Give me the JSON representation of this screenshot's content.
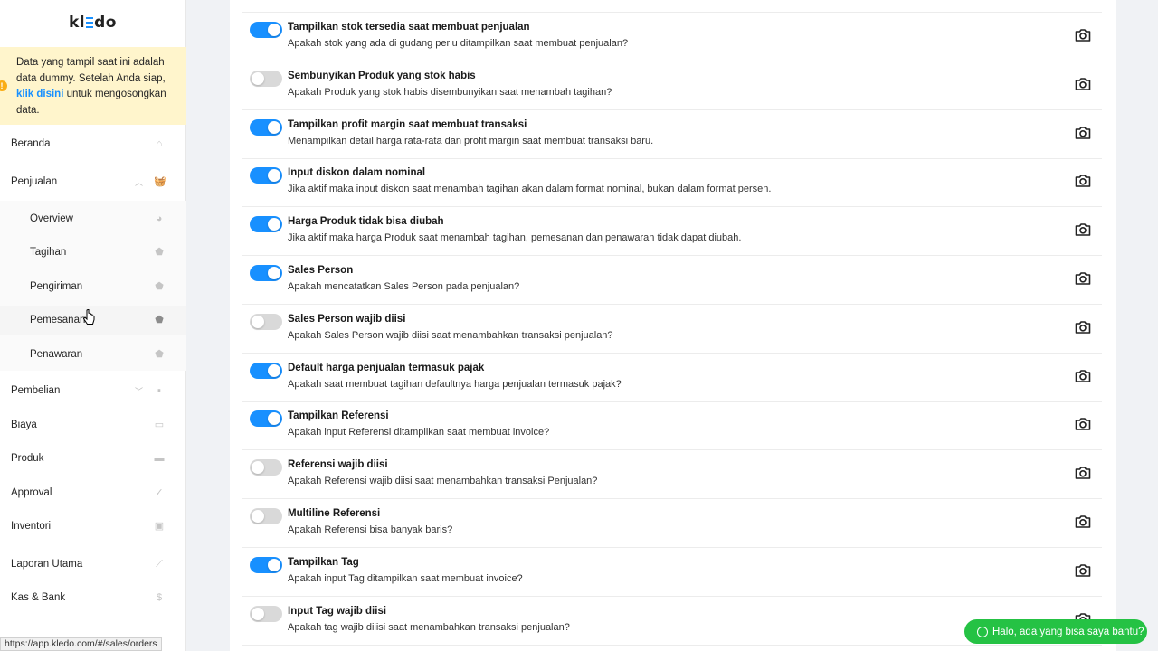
{
  "app": {
    "logo_text_left": "kl",
    "logo_text_right": "do"
  },
  "notice": {
    "text_before": "Data yang tampil saat ini adalah data dummy. Setelah Anda siap,",
    "link": "klik disini",
    "text_after": "untuk mengosongkan data."
  },
  "sidebar": {
    "items": [
      {
        "label": "Beranda",
        "icon": "home-icon"
      },
      {
        "label": "Penjualan",
        "icon": "basket-icon",
        "expanded": true
      },
      {
        "label": "Overview",
        "icon": "pie-icon"
      },
      {
        "label": "Tagihan",
        "icon": "tag-icon"
      },
      {
        "label": "Pengiriman",
        "icon": "tag-icon"
      },
      {
        "label": "Pemesanan",
        "icon": "tags-icon"
      },
      {
        "label": "Penawaran",
        "icon": "tag-icon"
      },
      {
        "label": "Pembelian",
        "icon": "bag-icon",
        "expanded": false
      },
      {
        "label": "Biaya",
        "icon": "card-icon"
      },
      {
        "label": "Produk",
        "icon": "box-icon"
      },
      {
        "label": "Approval",
        "icon": "check-icon"
      },
      {
        "label": "Inventori",
        "icon": "inventory-icon"
      },
      {
        "label": "Laporan Utama",
        "icon": "chart-icon"
      },
      {
        "label": "Kas & Bank",
        "icon": "dollar-icon"
      }
    ]
  },
  "status_bar": {
    "url": "https://app.kledo.com/#/sales/orders"
  },
  "settings": [
    {
      "title": "Tampilkan stok tersedia saat membuat penjualan",
      "desc": "Apakah stok yang ada di gudang perlu ditampilkan saat membuat penjualan?",
      "on": true
    },
    {
      "title": "Sembunyikan Produk yang stok habis",
      "desc": "Apakah Produk yang stok habis disembunyikan saat menambah tagihan?",
      "on": false
    },
    {
      "title": "Tampilkan profit margin saat membuat transaksi",
      "desc": "Menampilkan detail harga rata-rata dan profit margin saat membuat transaksi baru.",
      "on": true
    },
    {
      "title": "Input diskon dalam nominal",
      "desc": "Jika aktif maka input diskon saat menambah tagihan akan dalam format nominal, bukan dalam format persen.",
      "on": true
    },
    {
      "title": "Harga Produk tidak bisa diubah",
      "desc": "Jika aktif maka harga Produk saat menambah tagihan, pemesanan dan penawaran tidak dapat diubah.",
      "on": true
    },
    {
      "title": "Sales Person",
      "desc": "Apakah mencatatkan Sales Person pada penjualan?",
      "on": true
    },
    {
      "title": "Sales Person wajib diisi",
      "desc": "Apakah Sales Person wajib diisi saat menambahkan transaksi penjualan?",
      "on": false
    },
    {
      "title": "Default harga penjualan termasuk pajak",
      "desc": "Apakah saat membuat tagihan defaultnya harga penjualan termasuk pajak?",
      "on": true
    },
    {
      "title": "Tampilkan Referensi",
      "desc": "Apakah input Referensi ditampilkan saat membuat invoice?",
      "on": true
    },
    {
      "title": "Referensi wajib diisi",
      "desc": "Apakah Referensi wajib diisi saat menambahkan transaksi Penjualan?",
      "on": false
    },
    {
      "title": "Multiline Referensi",
      "desc": "Apakah Referensi bisa banyak baris?",
      "on": false
    },
    {
      "title": "Tampilkan Tag",
      "desc": "Apakah input Tag ditampilkan saat membuat invoice?",
      "on": true
    },
    {
      "title": "Input Tag wajib diisi",
      "desc": "Apakah tag wajib diiisi saat menambahkan transaksi penjualan?",
      "on": false
    }
  ],
  "whatsapp": {
    "label": "Halo, ada yang bisa saya bantu?"
  },
  "colors": {
    "accent": "#1890ff",
    "notice_bg": "#fff5cc",
    "whatsapp": "#25c244"
  }
}
